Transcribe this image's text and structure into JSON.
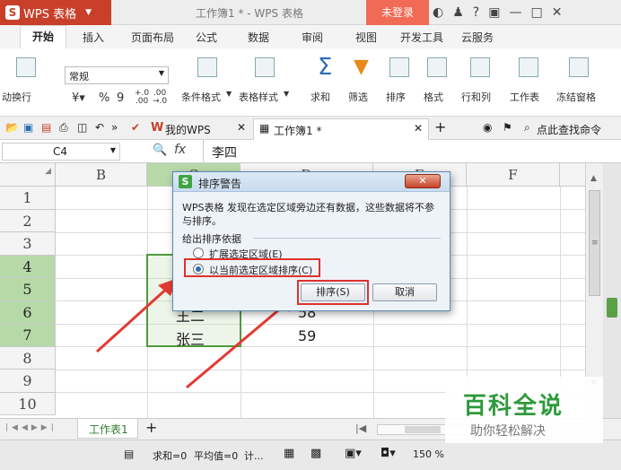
{
  "app": {
    "name": "WPS 表格",
    "doc_title": "工作簿1 * - WPS 表格",
    "login": "未登录",
    "title_icons": [
      "skin-icon",
      "shirt-icon",
      "help-icon",
      "restore-icon",
      "minimize-icon",
      "maximize-icon",
      "close-icon"
    ]
  },
  "menu": {
    "tabs": [
      "开始",
      "插入",
      "页面布局",
      "公式",
      "数据",
      "审阅",
      "视图",
      "开发工具",
      "云服务"
    ]
  },
  "ribbon": {
    "wrap": "动换行",
    "font_format": "常规",
    "percent": "%",
    "comma": "9",
    "cond_format": "条件格式",
    "table_style": "表格样式",
    "sum": "求和",
    "filter": "筛选",
    "sort": "排序",
    "format": "格式",
    "rowcol": "行和列",
    "sheet": "工作表",
    "freeze": "冻结窗格"
  },
  "filetabs": {
    "mywps": "我的WPS",
    "book": "工作簿1 *",
    "add": "+",
    "search": "点此查找命令"
  },
  "formula": {
    "cellref": "C4",
    "fx": "fx",
    "value": "李四"
  },
  "grid": {
    "columns": [
      "B",
      "C",
      "D",
      "E",
      "F"
    ],
    "rows": [
      "1",
      "2",
      "3",
      "4",
      "5",
      "6",
      "7",
      "8",
      "9",
      "10"
    ],
    "cells": {
      "c6": "王二",
      "c7": "张三",
      "d6": "58",
      "d7": "59"
    }
  },
  "sheetbar": {
    "sheet": "工作表1",
    "add": "+"
  },
  "status": {
    "sum": "求和=0",
    "avg": "平均值=0",
    "count": "计...",
    "zoom": "150 %"
  },
  "dialog": {
    "title": "排序警告",
    "message": "WPS表格 发现在选定区域旁边还有数据，这些数据将不参与排序。",
    "group_label": "给出排序依据",
    "option1": "扩展选定区域(E)",
    "option2": "以当前选定区域排序(C)",
    "selected_option": 2,
    "sort_button": "排序(S)",
    "cancel_button": "取消"
  },
  "watermark": {
    "line1": "百科全说",
    "line2": "助你轻松解决"
  },
  "colors": {
    "brand": "#c8402a",
    "login": "#f06a55",
    "selection": "#b7d9a8",
    "highlight": "#e0312c"
  }
}
